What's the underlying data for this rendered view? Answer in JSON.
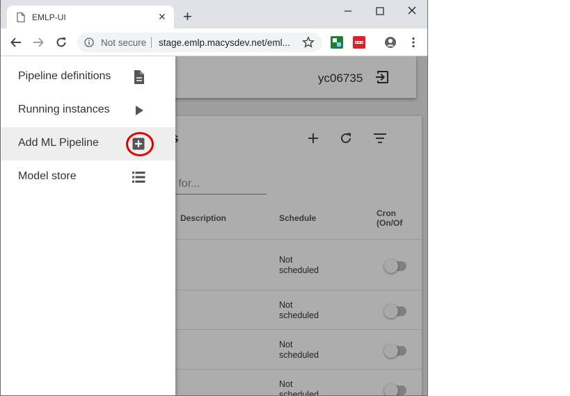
{
  "browser": {
    "tab": {
      "title": "EMLP-UI",
      "close": "✕",
      "icon": "page-icon"
    },
    "new_tab": "+",
    "window_controls": [
      "minimize-icon",
      "maximize-icon",
      "close-icon"
    ],
    "omnibox": {
      "security_label": "Not secure",
      "url": "stage.emlp.macysdev.net/eml..."
    },
    "extensions": [
      "extension-green-icon",
      "extension-red-icon",
      "profile-icon",
      "menu-kebab-icon"
    ]
  },
  "app": {
    "header": {
      "username": "yc06735",
      "logout_icon": "logout-icon"
    },
    "card": {
      "title_fragment": "s",
      "search_placeholder": "ch for...",
      "tools": [
        "add-icon",
        "refresh-icon",
        "filter-icon"
      ],
      "columns": {
        "description": "Description",
        "schedule": "Schedule",
        "cron_line1": "Cron",
        "cron_line2": "(On/Of"
      },
      "rows": [
        {
          "schedule_line1": "Not",
          "schedule_line2": "scheduled",
          "cron_enabled": false
        },
        {
          "schedule_line1": "Not",
          "schedule_line2": "scheduled",
          "cron_enabled": false
        },
        {
          "schedule_line1": "Not",
          "schedule_line2": "scheduled",
          "cron_enabled": false
        },
        {
          "schedule_line1": "Not",
          "schedule_line2": "scheduled",
          "cron_enabled": false
        }
      ]
    }
  },
  "drawer": {
    "items": [
      {
        "label": "Pipeline definitions",
        "icon": "document-icon",
        "active": false
      },
      {
        "label": "Running instances",
        "icon": "play-icon",
        "active": false
      },
      {
        "label": "Add ML Pipeline",
        "icon": "add-box-icon",
        "active": true
      },
      {
        "label": "Model store",
        "icon": "list-icon",
        "active": false
      }
    ],
    "highlight_color": "#e00000"
  }
}
